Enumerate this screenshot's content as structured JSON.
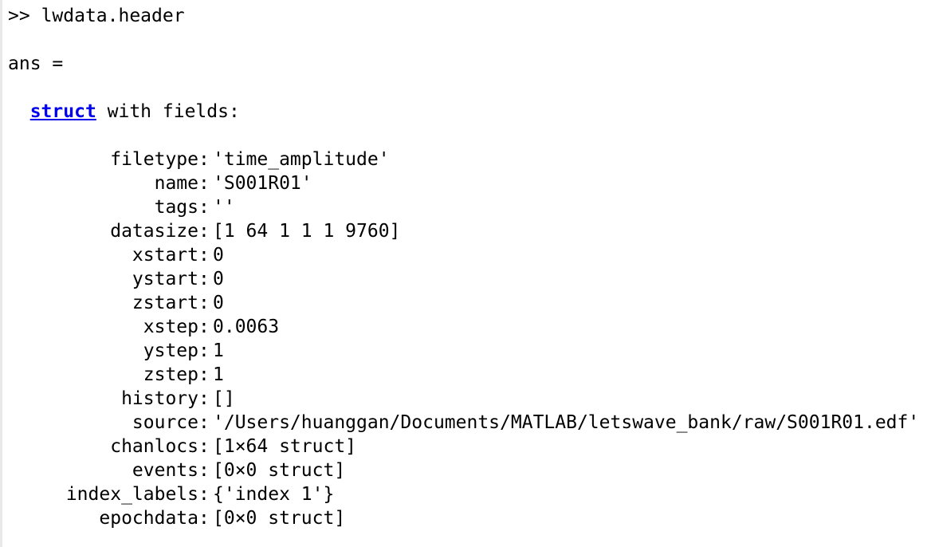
{
  "console": {
    "command_prompt": ">>",
    "command": "lwdata.header",
    "ans_label": "ans =",
    "struct_link": "struct",
    "struct_suffix": " with fields:",
    "colors": {
      "link": "#0000ee",
      "text": "#000000",
      "background": "#ffffff"
    },
    "fields": [
      {
        "key": "filetype",
        "value": "'time_amplitude'"
      },
      {
        "key": "name",
        "value": "'S001R01'"
      },
      {
        "key": "tags",
        "value": "''"
      },
      {
        "key": "datasize",
        "value": "[1 64 1 1 1 9760]"
      },
      {
        "key": "xstart",
        "value": "0"
      },
      {
        "key": "ystart",
        "value": "0"
      },
      {
        "key": "zstart",
        "value": "0"
      },
      {
        "key": "xstep",
        "value": "0.0063"
      },
      {
        "key": "ystep",
        "value": "1"
      },
      {
        "key": "zstep",
        "value": "1"
      },
      {
        "key": "history",
        "value": "[]"
      },
      {
        "key": "source",
        "value": "'/Users/huanggan/Documents/MATLAB/letswave_bank/raw/S001R01.edf'"
      },
      {
        "key": "chanlocs",
        "value": "[1×64 struct]"
      },
      {
        "key": "events",
        "value": "[0×0 struct]"
      },
      {
        "key": "index_labels",
        "value": "{'index 1'}"
      },
      {
        "key": "epochdata",
        "value": "[0×0 struct]"
      }
    ]
  }
}
